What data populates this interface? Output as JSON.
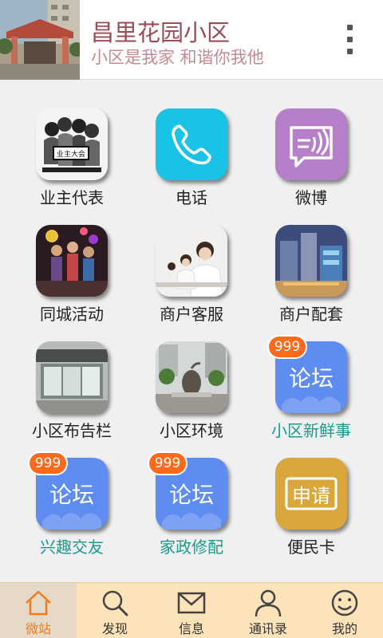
{
  "header": {
    "title": "昌里花园小区",
    "subtitle": "小区是我家  和谐你我他"
  },
  "grid": {
    "items": [
      {
        "label": "业主代表",
        "icon": "owners-meeting-photo",
        "tile_text": "业主大会"
      },
      {
        "label": "电话",
        "icon": "phone-icon"
      },
      {
        "label": "微博",
        "icon": "weibo-icon"
      },
      {
        "label": "同城活动",
        "icon": "city-events-photo"
      },
      {
        "label": "商户客服",
        "icon": "customer-service-photo"
      },
      {
        "label": "商户配套",
        "icon": "merchant-facilities-photo"
      },
      {
        "label": "小区布告栏",
        "icon": "bulletin-board-photo"
      },
      {
        "label": "小区环境",
        "icon": "community-environment-photo"
      },
      {
        "label": "小区新鲜事",
        "icon": "forum-icon",
        "tile_text": "论坛",
        "badge": "999"
      },
      {
        "label": "兴趣交友",
        "icon": "forum-icon",
        "tile_text": "论坛",
        "badge": "999"
      },
      {
        "label": "家政修配",
        "icon": "forum-icon",
        "tile_text": "论坛",
        "badge": "999"
      },
      {
        "label": "便民卡",
        "icon": "apply-card-icon",
        "tile_text": "申请"
      }
    ]
  },
  "bottom_nav": {
    "items": [
      {
        "label": "微站",
        "icon": "home-icon",
        "active": true
      },
      {
        "label": "发现",
        "icon": "search-icon"
      },
      {
        "label": "信息",
        "icon": "mail-icon"
      },
      {
        "label": "通讯录",
        "icon": "contacts-icon"
      },
      {
        "label": "我的",
        "icon": "smiley-icon"
      }
    ]
  },
  "colors": {
    "title": "#9b4d57",
    "subtitle": "#c58a90",
    "forum_blue": "#5f8cf0",
    "phone_cyan": "#19c3e6",
    "weibo_purple": "#b57fca",
    "apply_gold": "#d9a73c",
    "badge_orange": "#ff6a1a",
    "teal_label": "#1a9a8e",
    "nav_bg": "#fce3b9",
    "nav_active": "#f07c1b"
  }
}
